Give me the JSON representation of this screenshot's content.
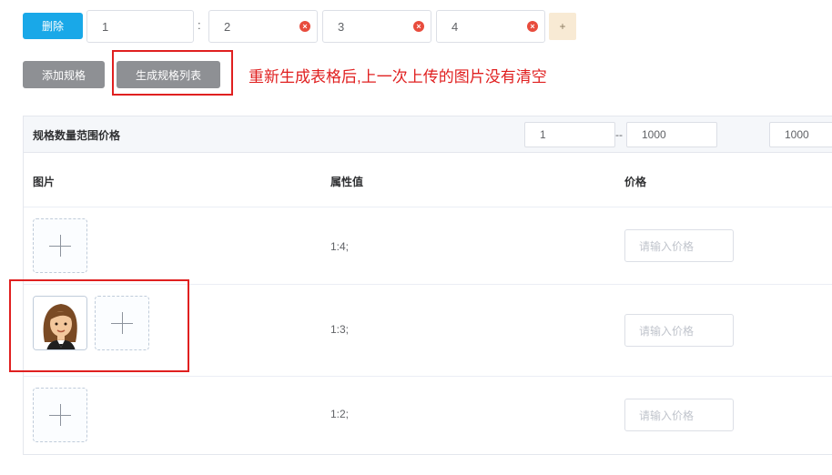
{
  "toolbar": {
    "delete_label": "删除",
    "spec_values": [
      "1",
      "2",
      "3",
      "4"
    ],
    "colon": ":",
    "add_value_label": "+",
    "add_spec_label": "添加规格",
    "generate_list_label": "生成规格列表",
    "annotation": "重新生成表格后,上一次上传的图片没有清空"
  },
  "range": {
    "label": "规格数量范围价格",
    "from": "1",
    "dash": "--",
    "to": "1000",
    "price": "1000"
  },
  "table": {
    "headers": {
      "image": "图片",
      "attr": "属性值",
      "price": "价格"
    },
    "rows": [
      {
        "attr": "1:4;",
        "price_placeholder": "请输入价格",
        "has_image": false
      },
      {
        "attr": "1:3;",
        "price_placeholder": "请输入价格",
        "has_image": true
      },
      {
        "attr": "1:2;",
        "price_placeholder": "请输入价格",
        "has_image": false
      }
    ]
  },
  "colors": {
    "primary": "#19a8e8",
    "gray_button": "#8e9094",
    "annotation_red": "#e02020",
    "success_green": "#13ce66"
  },
  "icons": [
    "clear-icon",
    "plus-icon",
    "check-icon",
    "avatar-image"
  ]
}
